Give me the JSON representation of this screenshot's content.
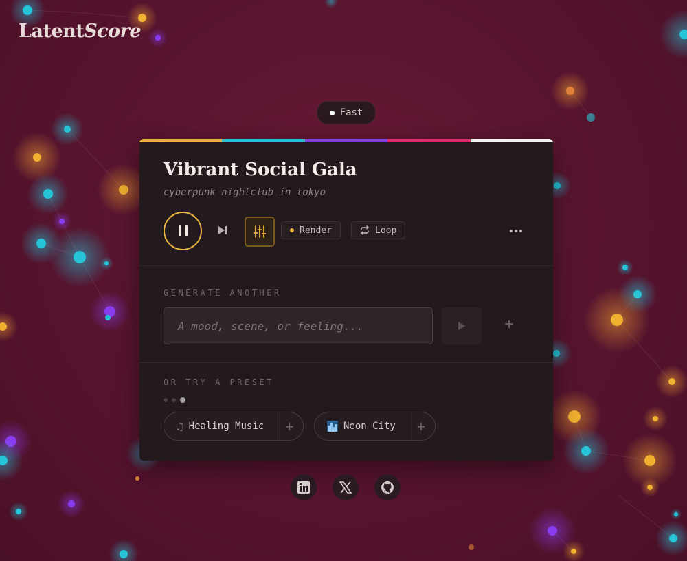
{
  "brand": {
    "logo_part1": "Latent",
    "logo_part2": "Score"
  },
  "mode": {
    "label": "Fast"
  },
  "colors": {
    "accent": "#e9b53e",
    "stripe": [
      "#e9b53e",
      "#27c4d8",
      "#7b3fe0",
      "#e0266a",
      "#f4f1ee"
    ]
  },
  "track": {
    "title": "Vibrant Social Gala",
    "prompt": "cyberpunk nightclub in tokyo"
  },
  "controls": {
    "play_state": "playing",
    "render_label": "Render",
    "loop_label": "Loop"
  },
  "generate": {
    "section_label": "GENERATE ANOTHER",
    "placeholder": "A mood, scene, or feeling..."
  },
  "presets": {
    "section_label": "OR TRY A PRESET",
    "page_count": 3,
    "active_page": 3,
    "items": [
      {
        "label": "Healing Music",
        "icon": "music-note-icon"
      },
      {
        "label": "Neon City",
        "icon": "city-skyline-icon"
      }
    ]
  },
  "social": [
    {
      "name": "linkedin",
      "icon": "linkedin-icon"
    },
    {
      "name": "x",
      "icon": "x-icon"
    },
    {
      "name": "github",
      "icon": "github-icon"
    }
  ]
}
